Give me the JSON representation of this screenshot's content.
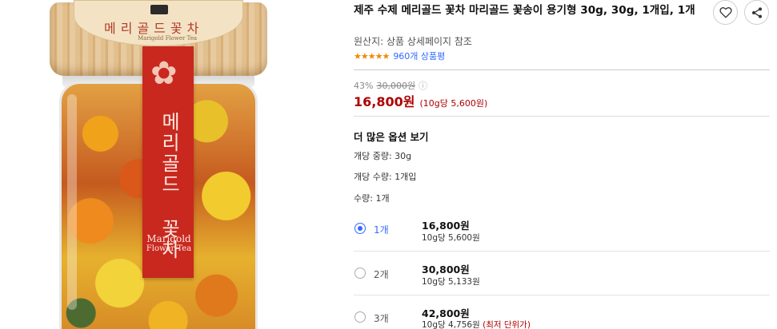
{
  "product": {
    "title": "제주 수제 메리골드 꽃차 마리골드 꽃송이 용기형 30g, 30g, 1개입, 1개",
    "origin": "원산지: 상품 상세페이지 참조",
    "rating_stars": "★★★★★",
    "rating_value": 4.5,
    "review_count": "960개 상품평"
  },
  "image": {
    "lid_text": "메리골드꽃차",
    "lid_sub": "Marigold Flower Tea",
    "band_korean": "메리골드 꽃차",
    "band_en_line1": "Marigold",
    "band_en_line2": "Flower Tea",
    "flower_glyph": "✿"
  },
  "pricing": {
    "discount": "43%",
    "original_price": "30,000원",
    "info_icon": "ⓘ",
    "price": "16,800원",
    "unit_price": "(10g당 5,600원)"
  },
  "options": {
    "heading": "더 많은 옵션 보기",
    "specs": [
      "개당 중량: 30g",
      "개당 수량: 1개입",
      "수량: 1개"
    ],
    "items": [
      {
        "label": "1개",
        "price": "16,800원",
        "unit": "10g당 5,600원",
        "note": "",
        "selected": true
      },
      {
        "label": "2개",
        "price": "30,800원",
        "unit": "10g당 5,133원",
        "note": "",
        "selected": false
      },
      {
        "label": "3개",
        "price": "42,800원",
        "unit": "10g당 4,756원",
        "note": "(최저 단위가)",
        "selected": false
      }
    ]
  },
  "icons": {
    "heart": "heart-icon",
    "share": "share-icon"
  },
  "colors": {
    "price_red": "#ae0000",
    "link_blue": "#346aff",
    "star_orange": "#f08a00",
    "band_red": "#c9281e"
  }
}
